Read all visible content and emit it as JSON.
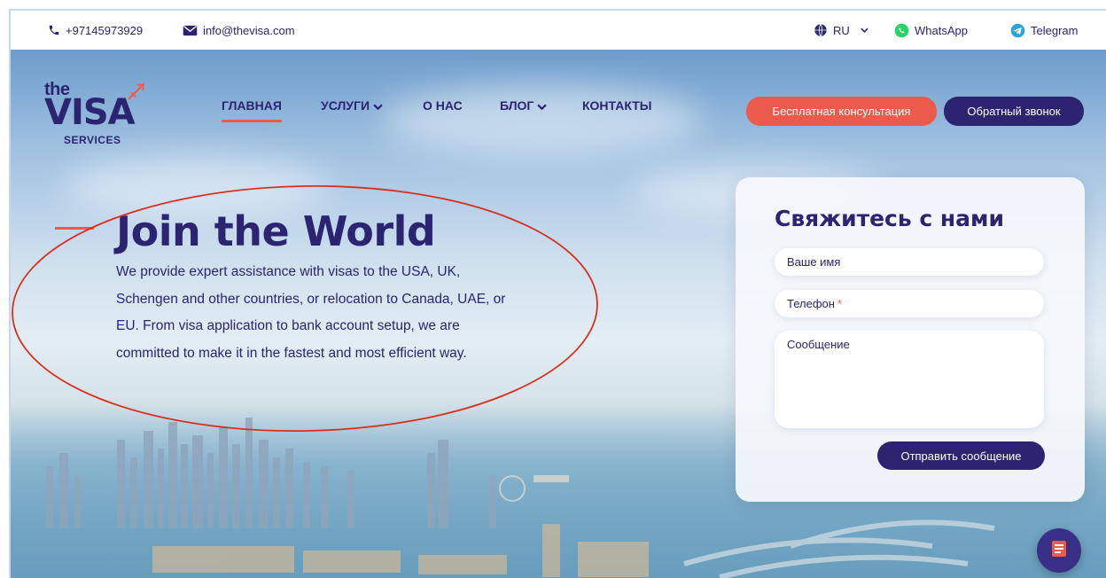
{
  "topbar": {
    "phone": "+97145973929",
    "email": "info@thevisa.com",
    "language": "RU",
    "whatsapp": "WhatsApp",
    "telegram": "Telegram"
  },
  "logo": {
    "line1": "the",
    "line2": "VISA",
    "line3": "SERVICES"
  },
  "nav": {
    "items": [
      {
        "label": "ГЛАВНАЯ",
        "active": true
      },
      {
        "label": "УСЛУГИ"
      },
      {
        "label": "О НАС"
      },
      {
        "label": "БЛОГ"
      },
      {
        "label": "КОНТАКТЫ"
      }
    ],
    "consult_button": "Бесплатная консультация",
    "callback_button": "Обратный звонок"
  },
  "hero": {
    "title": "Join the World",
    "text_lines": [
      "We provide expert assistance with visas to the USA, UK,",
      "Schengen and other countries, or relocation to Canada, UAE, or",
      "EU. From visa application to bank account setup, we are",
      "committed to make it in the fastest and most efficient way."
    ]
  },
  "contact_form": {
    "title": "Свяжитесь с нами",
    "name_placeholder": "Ваше имя",
    "phone_placeholder": "Телефон",
    "phone_required_mark": "*",
    "message_placeholder": "Сообщение",
    "submit_label": "Отправить сообщение"
  },
  "colors": {
    "brand_navy": "#2b2470",
    "accent_coral": "#ec5a4c",
    "whatsapp_green": "#25d366",
    "telegram_blue": "#2aa3df",
    "annotation_red": "#d8301f"
  }
}
